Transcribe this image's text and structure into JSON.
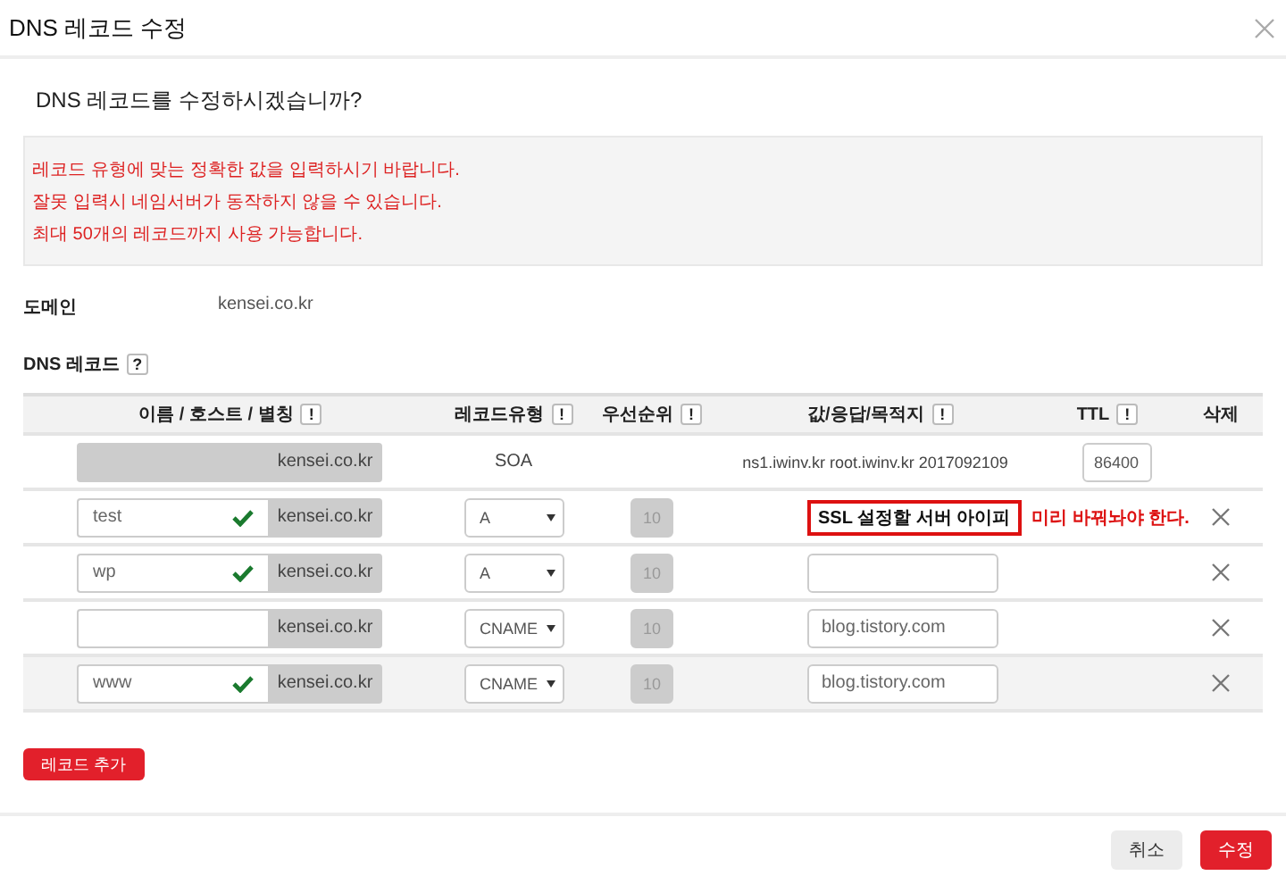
{
  "dialog": {
    "title": "DNS 레코드 수정"
  },
  "question": "DNS 레코드를 수정하시겠습니까?",
  "notices": [
    "레코드 유형에 맞는 정확한 값을 입력하시기 바랍니다.",
    "잘못 입력시 네임서버가 동작하지 않을 수 있습니다.",
    "최대 50개의 레코드까지 사용 가능합니다."
  ],
  "domain": {
    "label": "도메인",
    "value": "kensei.co.kr"
  },
  "records": {
    "label": "DNS 레코드",
    "help": "?"
  },
  "table": {
    "columns": [
      {
        "label": "이름 / 호스트 / 별칭",
        "help": "!"
      },
      {
        "label": "레코드유형",
        "help": "!"
      },
      {
        "label": "우선순위",
        "help": "!"
      },
      {
        "label": "값/응답/목적지",
        "help": "!"
      },
      {
        "label": "TTL",
        "help": "!"
      },
      {
        "label": "삭제"
      }
    ],
    "rows": [
      {
        "kind": "soa",
        "suffix": "kensei.co.kr",
        "type": "SOA",
        "value": "ns1.iwinv.kr root.iwinv.kr 2017092109",
        "ttl": "86400",
        "hovered": false
      },
      {
        "kind": "record",
        "host": "test",
        "valid": true,
        "suffix": "kensei.co.kr",
        "type": "A",
        "priority": "10",
        "priority_disabled": true,
        "note": "SSL 설정할 서버 아이피",
        "side_note": "미리 바꿔놔야 한다.",
        "hovered": false
      },
      {
        "kind": "record",
        "host": "wp",
        "valid": true,
        "suffix": "kensei.co.kr",
        "type": "A",
        "priority": "10",
        "priority_disabled": true,
        "hovered": false
      },
      {
        "kind": "record",
        "valid": false,
        "suffix": "kensei.co.kr",
        "type": "CNAME",
        "priority": "10",
        "priority_disabled": true,
        "value": "blog.tistory.com",
        "hovered": false
      },
      {
        "kind": "record",
        "host": "www",
        "valid": true,
        "suffix": "kensei.co.kr",
        "type": "CNAME",
        "priority": "10",
        "priority_disabled": true,
        "value": "blog.tistory.com",
        "hovered": true
      }
    ]
  },
  "add_button": "레코드 추가",
  "buttons": [
    {
      "label": "취소",
      "kind": "secondary"
    },
    {
      "label": "수정",
      "kind": "primary"
    }
  ]
}
